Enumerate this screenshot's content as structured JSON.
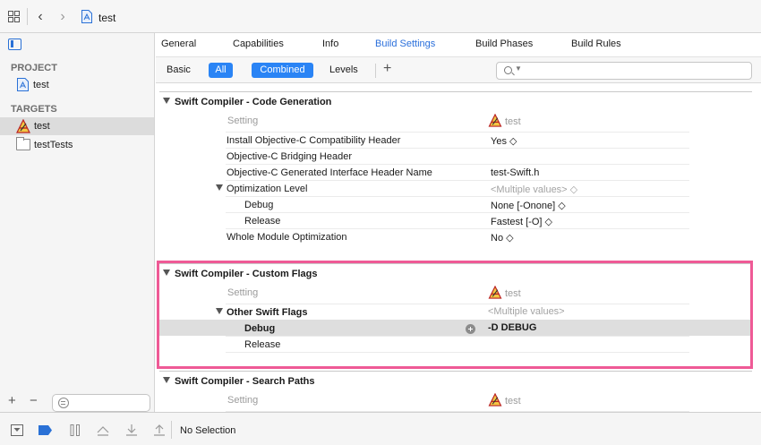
{
  "window": {
    "title": "test"
  },
  "sidebar": {
    "project_header": "PROJECT",
    "project_name": "test",
    "targets_header": "TARGETS",
    "targets": [
      {
        "label": "test",
        "selected": true
      },
      {
        "label": "testTests",
        "selected": false
      }
    ]
  },
  "tabs": [
    {
      "label": "General"
    },
    {
      "label": "Capabilities"
    },
    {
      "label": "Info"
    },
    {
      "label": "Build Settings",
      "active": true
    },
    {
      "label": "Build Phases"
    },
    {
      "label": "Build Rules"
    }
  ],
  "filter": {
    "basic": "Basic",
    "all": "All",
    "combined": "Combined",
    "levels": "Levels",
    "search_placeholder": ""
  },
  "sections": [
    {
      "title": "Swift Compiler - Code Generation",
      "col_setting": "Setting",
      "col_target": "test",
      "rows": [
        {
          "label": "Install Objective-C Compatibility Header",
          "value": "Yes ◇"
        },
        {
          "label": "Objective-C Bridging Header",
          "value": ""
        },
        {
          "label": "Objective-C Generated Interface Header Name",
          "value": "test-Swift.h"
        },
        {
          "label": "Optimization Level",
          "value": "<Multiple values> ◇"
        },
        {
          "label": "Debug",
          "value": "None [-Onone] ◇"
        },
        {
          "label": "Release",
          "value": "Fastest [-O] ◇"
        },
        {
          "label": "Whole Module Optimization",
          "value": "No ◇"
        }
      ]
    },
    {
      "title": "Swift Compiler - Custom Flags",
      "col_setting": "Setting",
      "col_target": "test",
      "rows": [
        {
          "label": "Other Swift Flags",
          "value": "<Multiple values>"
        },
        {
          "label": "Debug",
          "value": "-D DEBUG"
        },
        {
          "label": "Release",
          "value": ""
        }
      ]
    },
    {
      "title": "Swift Compiler - Search Paths",
      "col_setting": "Setting",
      "col_target": "test",
      "rows": []
    }
  ],
  "status": {
    "text": "No Selection"
  },
  "colors": {
    "accent": "#2a84f5",
    "highlight": "#ef5a96"
  }
}
